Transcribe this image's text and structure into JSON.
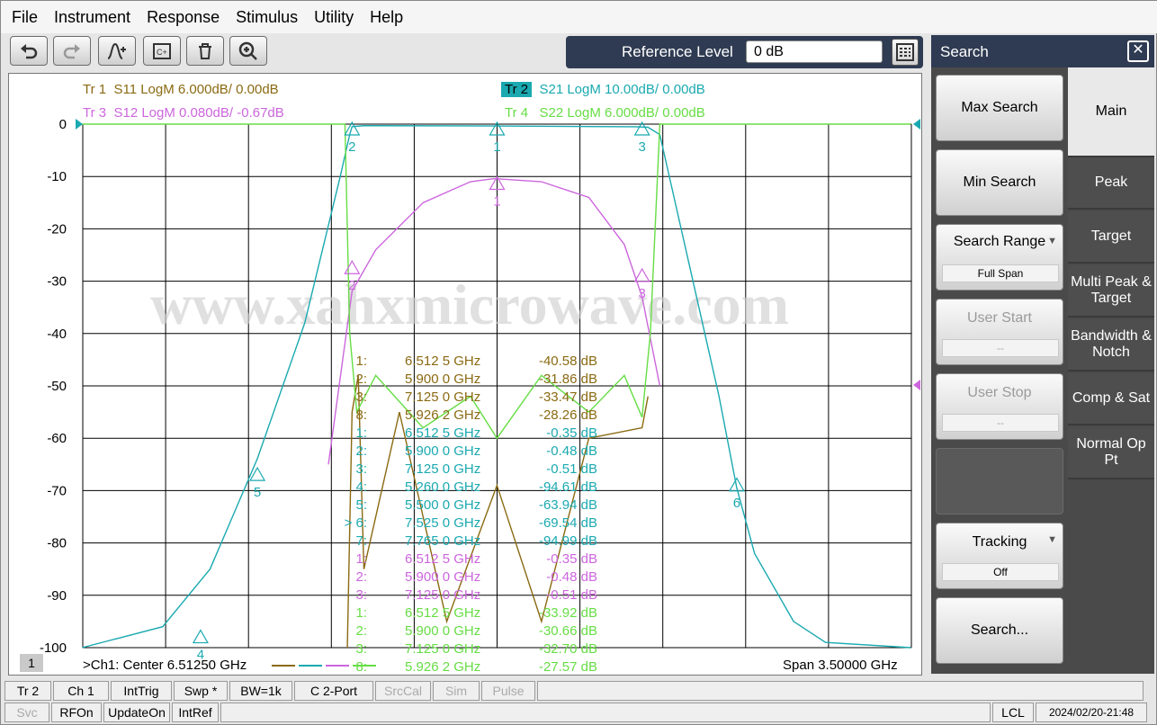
{
  "menu": [
    "File",
    "Instrument",
    "Response",
    "Stimulus",
    "Utility",
    "Help"
  ],
  "toolbar": {
    "buttons": [
      "undo-icon",
      "redo-icon",
      "add-marker-icon",
      "channel-icon",
      "delete-icon",
      "zoom-icon"
    ]
  },
  "reference": {
    "label": "Reference Level",
    "value": "0 dB"
  },
  "traces": {
    "tr1": {
      "id": "Tr 1",
      "desc": "S11 LogM 6.000dB/  0.00dB",
      "color": "#8a6a12"
    },
    "tr2": {
      "id": "Tr 2",
      "desc": "S21 LogM 10.00dB/  0.00dB",
      "color": "#1aa9b0"
    },
    "tr3": {
      "id": "Tr 3",
      "desc": "S12 LogM 0.080dB/  -0.67dB",
      "color": "#cc66dd"
    },
    "tr4": {
      "id": "Tr 4",
      "desc": "S22 LogM 6.000dB/  0.00dB",
      "color": "#66dd44"
    }
  },
  "watermark": "www.xahxmicrowave.com",
  "chart_data": {
    "type": "line",
    "y_ticks": [
      "0",
      "-10",
      "-20",
      "-30",
      "-40",
      "-50",
      "-60",
      "-70",
      "-80",
      "-90",
      "-100"
    ],
    "ylim": [
      -100,
      0
    ],
    "xlim_ghz": [
      4.7625,
      8.2625
    ],
    "center": ">Ch1:  Center  6.51250 GHz",
    "span": "Span  3.50000 GHz",
    "channel_badge": "1",
    "series": [
      {
        "name": "S21",
        "x": [
          4.76,
          5.1,
          5.3,
          5.5,
          5.7,
          5.85,
          5.89,
          5.9,
          5.95,
          6.0,
          6.5,
          7.1,
          7.15,
          7.2,
          7.3,
          7.45,
          7.525,
          7.6,
          7.765,
          7.9,
          8.26
        ],
        "values": [
          -100,
          -96,
          -85,
          -63.9,
          -38,
          -10,
          -2,
          -0.48,
          -0.3,
          -0.3,
          -0.35,
          -0.51,
          -0.6,
          -2,
          -22,
          -52,
          -69.5,
          -82,
          -95,
          -99,
          -100
        ]
      },
      {
        "name": "S12",
        "x": [
          5.8,
          5.9,
          6.0,
          6.2,
          6.4,
          6.5,
          6.7,
          6.9,
          7.05,
          7.125,
          7.2
        ],
        "values": [
          -65,
          -31.9,
          -24,
          -15,
          -11,
          -10.4,
          -11,
          -14,
          -23,
          -33,
          -50
        ]
      },
      {
        "name": "S11",
        "x": [
          5.88,
          5.9,
          5.926,
          5.95,
          6.1,
          6.3,
          6.512,
          6.7,
          6.9,
          7.125,
          7.15
        ],
        "values": [
          -100,
          -55,
          -48,
          -85,
          -55,
          -95,
          -69,
          -95,
          -60,
          -58,
          -52
        ]
      },
      {
        "name": "S22",
        "x": [
          4.76,
          5.87,
          5.89,
          5.92,
          6.0,
          6.2,
          6.4,
          6.512,
          6.7,
          6.9,
          7.05,
          7.125,
          7.16,
          7.2,
          8.26
        ],
        "values": [
          0,
          0,
          -40,
          -55,
          -48,
          -58,
          -52,
          -60,
          -48,
          -55,
          -48,
          -56,
          -40,
          0,
          0
        ]
      }
    ],
    "markers_on_plot": [
      {
        "label": "1",
        "trace": "S21",
        "x": 6.5125,
        "y": 0
      },
      {
        "label": "2",
        "trace": "S21",
        "x": 5.9,
        "y": 0
      },
      {
        "label": "3",
        "trace": "S21",
        "x": 7.125,
        "y": 0
      },
      {
        "label": "1",
        "trace": "S12",
        "x": 6.5125,
        "y": -10.4
      },
      {
        "label": "2",
        "trace": "S12",
        "x": 5.9,
        "y": -26.5
      },
      {
        "label": "3",
        "trace": "S12",
        "x": 7.125,
        "y": -28
      },
      {
        "label": "5",
        "trace": "S21",
        "x": 5.5,
        "y": -66
      },
      {
        "label": "6",
        "trace": "S21",
        "x": 7.525,
        "y": -68
      },
      {
        "label": "4",
        "trace": "S21",
        "x": 5.26,
        "y": -97
      }
    ],
    "marker_table": [
      {
        "sel": "",
        "n": "1:",
        "f": "6.512 5 GHz",
        "v": "-40.58 dB",
        "color": "#8a6a12"
      },
      {
        "sel": "",
        "n": "2:",
        "f": "5.900 0 GHz",
        "v": "-31.86 dB",
        "color": "#8a6a12"
      },
      {
        "sel": "",
        "n": "3:",
        "f": "7.125 0 GHz",
        "v": "-33.47 dB",
        "color": "#8a6a12"
      },
      {
        "sel": "",
        "n": "8:",
        "f": "5.926 2 GHz",
        "v": "-28.26 dB",
        "color": "#8a6a12"
      },
      {
        "sel": "",
        "n": "1:",
        "f": "6.512 5 GHz",
        "v": "-0.35 dB",
        "color": "#1aa9b0"
      },
      {
        "sel": "",
        "n": "2:",
        "f": "5.900 0 GHz",
        "v": "-0.48 dB",
        "color": "#1aa9b0"
      },
      {
        "sel": "",
        "n": "3:",
        "f": "7.125 0 GHz",
        "v": "-0.51 dB",
        "color": "#1aa9b0"
      },
      {
        "sel": "",
        "n": "4:",
        "f": "5.260 0 GHz",
        "v": "-94.61 dB",
        "color": "#1aa9b0"
      },
      {
        "sel": "",
        "n": "5:",
        "f": "5.500 0 GHz",
        "v": "-63.94 dB",
        "color": "#1aa9b0"
      },
      {
        "sel": "> ",
        "n": "6:",
        "f": "7.525 0 GHz",
        "v": "-69.54 dB",
        "color": "#1aa9b0"
      },
      {
        "sel": "",
        "n": "7:",
        "f": "7.765 0 GHz",
        "v": "-94.99 dB",
        "color": "#1aa9b0"
      },
      {
        "sel": "",
        "n": "1:",
        "f": "6.512 5 GHz",
        "v": "-0.35 dB",
        "color": "#cc66dd"
      },
      {
        "sel": "",
        "n": "2:",
        "f": "5.900 0 GHz",
        "v": "-0.48 dB",
        "color": "#cc66dd"
      },
      {
        "sel": "",
        "n": "3:",
        "f": "7.125 0 GHz",
        "v": "-0.51 dB",
        "color": "#cc66dd"
      },
      {
        "sel": "",
        "n": "1:",
        "f": "6.512 5 GHz",
        "v": "-33.92 dB",
        "color": "#66dd44"
      },
      {
        "sel": "",
        "n": "2:",
        "f": "5.900 0 GHz",
        "v": "-30.66 dB",
        "color": "#66dd44"
      },
      {
        "sel": "",
        "n": "3:",
        "f": "7.125 0 GHz",
        "v": "-32.70 dB",
        "color": "#66dd44"
      },
      {
        "sel": "",
        "n": "8:",
        "f": "5.926 2 GHz",
        "v": "-27.57 dB",
        "color": "#66dd44"
      }
    ]
  },
  "search_panel": {
    "title": "Search",
    "max_search": "Max Search",
    "min_search": "Min Search",
    "search_range": "Search Range",
    "search_range_value": "Full Span",
    "user_start": "User Start",
    "user_start_value": "--",
    "user_stop": "User Stop",
    "user_stop_value": "--",
    "tracking": "Tracking",
    "tracking_value": "Off",
    "search_more": "Search...",
    "tabs": [
      {
        "label": "Main",
        "active": true
      },
      {
        "label": "Peak"
      },
      {
        "label": "Target"
      },
      {
        "label": "Multi Peak & Target"
      },
      {
        "label": "Bandwidth & Notch"
      },
      {
        "label": "Comp & Sat"
      },
      {
        "label": "Normal Op Pt"
      }
    ]
  },
  "status1": [
    "Tr 2",
    "Ch 1",
    "IntTrig",
    "Swp *",
    "BW=1k",
    "C  2-Port",
    "SrcCal",
    "Sim",
    "Pulse"
  ],
  "status2": [
    "Svc",
    "RFOn",
    "UpdateOn",
    "IntRef"
  ],
  "status_right": {
    "lcl": "LCL",
    "datetime": "2024/02/20-21:48"
  }
}
